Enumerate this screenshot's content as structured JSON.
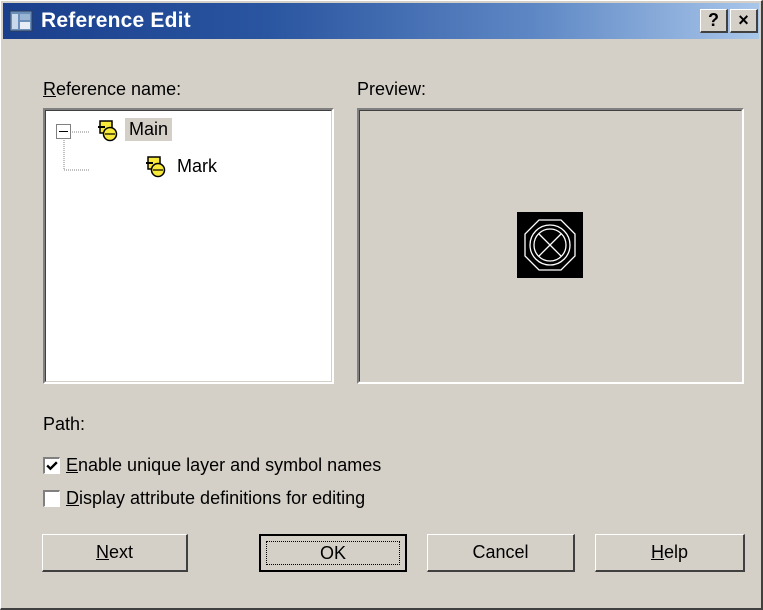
{
  "window": {
    "title": "Reference Edit",
    "help_btn": "?",
    "close_btn": "×"
  },
  "reference_name": {
    "label_accel": "R",
    "label_rest": "eference name:"
  },
  "tree": {
    "root_label": "Main",
    "child_label": "Mark",
    "expander": "−"
  },
  "preview": {
    "label": "Preview:"
  },
  "path": {
    "label": "Path:"
  },
  "options": {
    "enable_unique": {
      "accel": "E",
      "rest": "nable unique layer and symbol names",
      "checked": true
    },
    "display_attr": {
      "accel": "D",
      "rest": "isplay attribute definitions for editing",
      "checked": false
    }
  },
  "buttons": {
    "next_accel": "N",
    "next_rest": "ext",
    "ok": "OK",
    "cancel": "Cancel",
    "help_accel": "H",
    "help_rest": "elp"
  },
  "colors": {
    "face": "#d4d0c8",
    "title_dark": "#1a3f8c",
    "title_light": "#a9c6ea",
    "icon_yellow": "#f7ea3a"
  }
}
